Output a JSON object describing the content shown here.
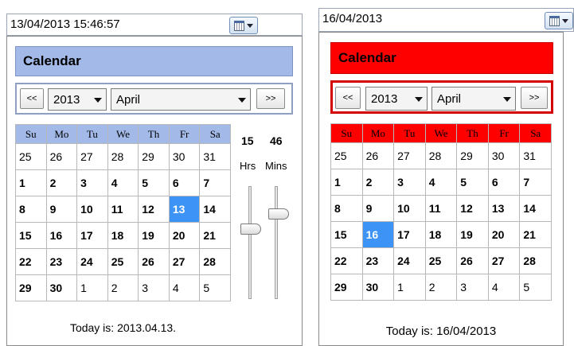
{
  "weekday_headers": [
    "Su",
    "Mo",
    "Tu",
    "We",
    "Th",
    "Fr",
    "Sa"
  ],
  "left": {
    "datetime_value": "13/04/2013 15:46:57",
    "calendar_title": "Calendar",
    "prev_label": "<<",
    "next_label": ">>",
    "year": "2013",
    "month": "April",
    "time_hours": "15",
    "time_minutes": "46",
    "hours_label": "Hrs",
    "minutes_label": "Mins",
    "hours_level": 0.63,
    "minutes_level": 0.78,
    "today_text": "Today is: 2013.04.13.",
    "colors": {
      "title_bg": "#a3bae8",
      "header_bg": "#a3bae8",
      "nav_border": "#8f9fc4",
      "selected_bg": "#3d94f6"
    },
    "weeks": [
      [
        "25",
        "26",
        "27",
        "28",
        "29",
        "30",
        "31"
      ],
      [
        "1",
        "2",
        "3",
        "4",
        "5",
        "6",
        "7"
      ],
      [
        "8",
        "9",
        "10",
        "11",
        "12",
        "13",
        "14"
      ],
      [
        "15",
        "16",
        "17",
        "18",
        "19",
        "20",
        "21"
      ],
      [
        "22",
        "23",
        "24",
        "25",
        "26",
        "27",
        "28"
      ],
      [
        "29",
        "30",
        "1",
        "2",
        "3",
        "4",
        "5"
      ]
    ],
    "selected_day": "13"
  },
  "right": {
    "date_value": "16/04/2013",
    "calendar_title": "Calendar",
    "prev_label": "<<",
    "next_label": ">>",
    "year": "2013",
    "month": "April",
    "today_text": "Today is: 16/04/2013",
    "colors": {
      "title_bg": "#ff0000",
      "header_bg": "#ff0000",
      "nav_border": "#d40000",
      "selected_bg": "#3d94f6"
    },
    "weeks": [
      [
        "25",
        "26",
        "27",
        "28",
        "29",
        "30",
        "31"
      ],
      [
        "1",
        "2",
        "3",
        "4",
        "5",
        "6",
        "7"
      ],
      [
        "8",
        "9",
        "10",
        "11",
        "12",
        "13",
        "14"
      ],
      [
        "15",
        "16",
        "17",
        "18",
        "19",
        "20",
        "21"
      ],
      [
        "22",
        "23",
        "24",
        "25",
        "26",
        "27",
        "28"
      ],
      [
        "29",
        "30",
        "1",
        "2",
        "3",
        "4",
        "5"
      ]
    ],
    "selected_day": "16"
  }
}
